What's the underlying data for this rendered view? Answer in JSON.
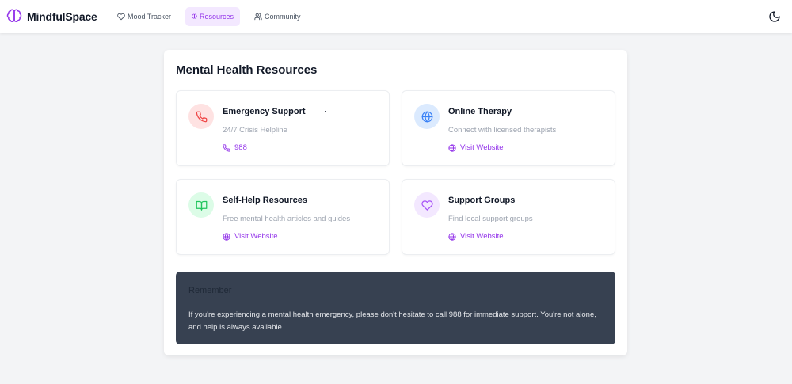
{
  "brand": {
    "name": "MindfulSpace",
    "icon": "brain-icon",
    "accent": "#9333ea"
  },
  "nav": {
    "items": [
      {
        "label": "Mood Tracker",
        "icon": "heart-icon",
        "active": false
      },
      {
        "label": "Resources",
        "icon": "brain-icon",
        "active": true
      },
      {
        "label": "Community",
        "icon": "users-icon",
        "active": false
      }
    ],
    "theme_toggle_icon": "moon-icon"
  },
  "main": {
    "title": "Mental Health Resources",
    "cards": [
      {
        "title": "Emergency Support",
        "description": "24/7 Crisis Helpline",
        "link": "988",
        "icon": "phone-icon",
        "link_icon": "phone-icon",
        "icon_bg": "#fee2e2",
        "icon_color": "#ef4444"
      },
      {
        "title": "Online Therapy",
        "description": "Connect with licensed therapists",
        "link": "Visit Website",
        "icon": "globe-icon",
        "link_icon": "globe-icon",
        "icon_bg": "#dbeafe",
        "icon_color": "#3b82f6"
      },
      {
        "title": "Self-Help Resources",
        "description": "Free mental health articles and guides",
        "link": "Visit Website",
        "icon": "book-icon",
        "link_icon": "globe-icon",
        "icon_bg": "#dcfce7",
        "icon_color": "#22c55e"
      },
      {
        "title": "Support Groups",
        "description": "Find local support groups",
        "link": "Visit Website",
        "icon": "heart-icon",
        "link_icon": "globe-icon",
        "icon_bg": "#f3e8ff",
        "icon_color": "#a855f7"
      }
    ],
    "remember": {
      "title": "Remember",
      "text": "If you're experiencing a mental health emergency, please don't hesitate to call 988 for immediate support. You're not alone, and help is always available."
    }
  }
}
